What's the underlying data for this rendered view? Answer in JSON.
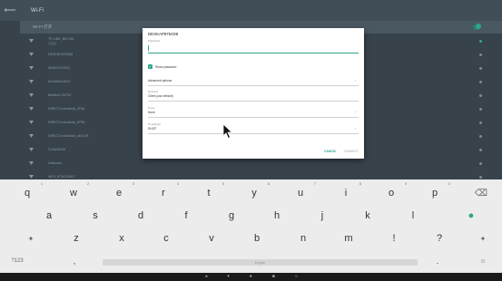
{
  "toolbar": {
    "title": "Wi-Fi"
  },
  "wifi_header": {
    "label": "WI-FI 打开"
  },
  "networks": [
    {
      "name": "TP-LINK_B51736",
      "sub": "已连接",
      "active": true
    },
    {
      "name": "DESKAP8754D8",
      "sub": "",
      "active": false
    },
    {
      "name": "ANSH-EVX521",
      "sub": "",
      "active": false
    },
    {
      "name": "ALIBABA-MOD",
      "sub": "",
      "active": false
    },
    {
      "name": "BuffaloG-26753",
      "sub": "",
      "active": false
    },
    {
      "name": "DIRECT-mAndroid_4T5a",
      "sub": "",
      "active": false
    },
    {
      "name": "DIRECT-mAndroid_cFPA",
      "sub": "",
      "active": false
    },
    {
      "name": "DIRECT-mAndroid_uGUCR",
      "sub": "",
      "active": false
    },
    {
      "name": "CLINADOM",
      "sub": "",
      "active": false
    },
    {
      "name": "Unknown",
      "sub": "",
      "active": false
    },
    {
      "name": "WEX_6734724017",
      "sub": "",
      "active": false
    }
  ],
  "dialog": {
    "title": "DESKAP8754D8",
    "password_label": "Password",
    "show_password": "Show password",
    "fields": [
      {
        "label": "Advanced options",
        "value": ""
      },
      {
        "label": "Network",
        "value": "Client (use default)"
      },
      {
        "label": "Proxy",
        "value": "None"
      },
      {
        "label": "IP settings",
        "value": "DHCP"
      }
    ],
    "cancel": "CANCEL",
    "connect": "CONNECT"
  },
  "keyboard": {
    "row1": [
      "q",
      "w",
      "e",
      "r",
      "t",
      "y",
      "u",
      "i",
      "o",
      "p"
    ],
    "row1_hints": [
      "1",
      "2",
      "3",
      "4",
      "5",
      "6",
      "7",
      "8",
      "9",
      "0"
    ],
    "row2": [
      "a",
      "s",
      "d",
      "f",
      "g",
      "h",
      "j",
      "k",
      "l"
    ],
    "row3": [
      "z",
      "x",
      "c",
      "v",
      "b",
      "n",
      "m",
      "!",
      "?"
    ],
    "mode": "?123",
    "comma": ",",
    "period": ".",
    "space": "English",
    "shift": "✦",
    "backspace": "⌫",
    "enter": "●",
    "emoji": "☺"
  },
  "navbar": {
    "icons": [
      "◂",
      "▾",
      "●",
      "■",
      "◃"
    ]
  },
  "colors": {
    "accent": "#2fa58c",
    "keyboard_bg": "#ececec",
    "dim_bg": "#37424b"
  }
}
